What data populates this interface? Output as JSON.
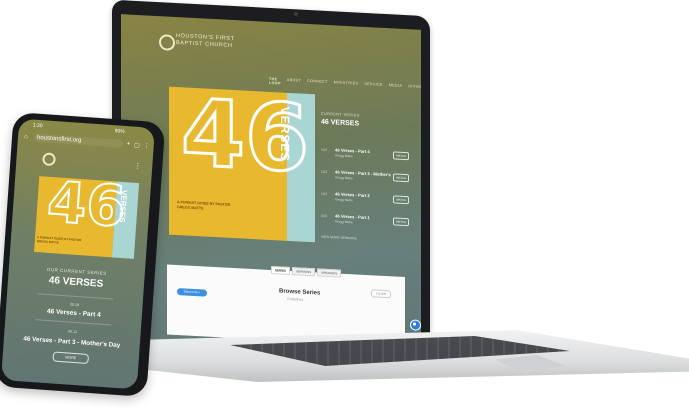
{
  "laptop": {
    "logo": {
      "line1": "HOUSTON'S FIRST",
      "line2": "BAPTIST CHURCH"
    },
    "nav": [
      "THE LOOP",
      "ABOUT",
      "CONNECT",
      "MINISTRIES",
      "SERVICE",
      "MEDIA",
      "GIVING"
    ],
    "hero": {
      "number": "46",
      "word": "VERSES",
      "tagline": "A PURSUIT GUIDE BY PASTOR GREGG MATTE"
    },
    "series": {
      "kicker": "CURRENT SERIES",
      "title": "46 VERSES",
      "episodes": [
        {
          "date": "10.6",
          "title": "46 Verses - Part 4",
          "speaker": "Gregg Matte",
          "button": "WATCH"
        },
        {
          "date": "10.6",
          "title": "46 Verses - Part 3 - Mother's",
          "speaker": "Gregg Matte",
          "button": "WATCH"
        },
        {
          "date": "10.6",
          "title": "46 Verses - Part 2",
          "speaker": "Gregg Matte",
          "button": "WATCH"
        },
        {
          "date": "10.6",
          "title": "46 Verses - Part 1",
          "speaker": "Gregg Matte",
          "button": "WATCH"
        }
      ],
      "more": "VIEW MORE SERMONS"
    },
    "tabs": [
      "SERIES",
      "SERMONS",
      "SPEAKERS"
    ],
    "browse": {
      "title": "Browse Series",
      "subtitle": "Guidelines",
      "show_info": "Show Info",
      "filter": "FILTER"
    }
  },
  "phone": {
    "status": {
      "time": "1:20",
      "battery": "90%"
    },
    "url": "houstonsfirst.org",
    "hero": {
      "number": "46",
      "word": "VERSES",
      "tagline": "A PURSUIT GUIDE BY PASTOR GREGG MATTE"
    },
    "kicker": "OUR CURRENT SERIES",
    "title": "46 VERSES",
    "items": [
      {
        "date": "05.19",
        "title": "46 Verses - Part 4"
      },
      {
        "date": "05.12",
        "title": "46 Verses - Part 3 - Mother's Day"
      }
    ],
    "button": "MORE"
  }
}
